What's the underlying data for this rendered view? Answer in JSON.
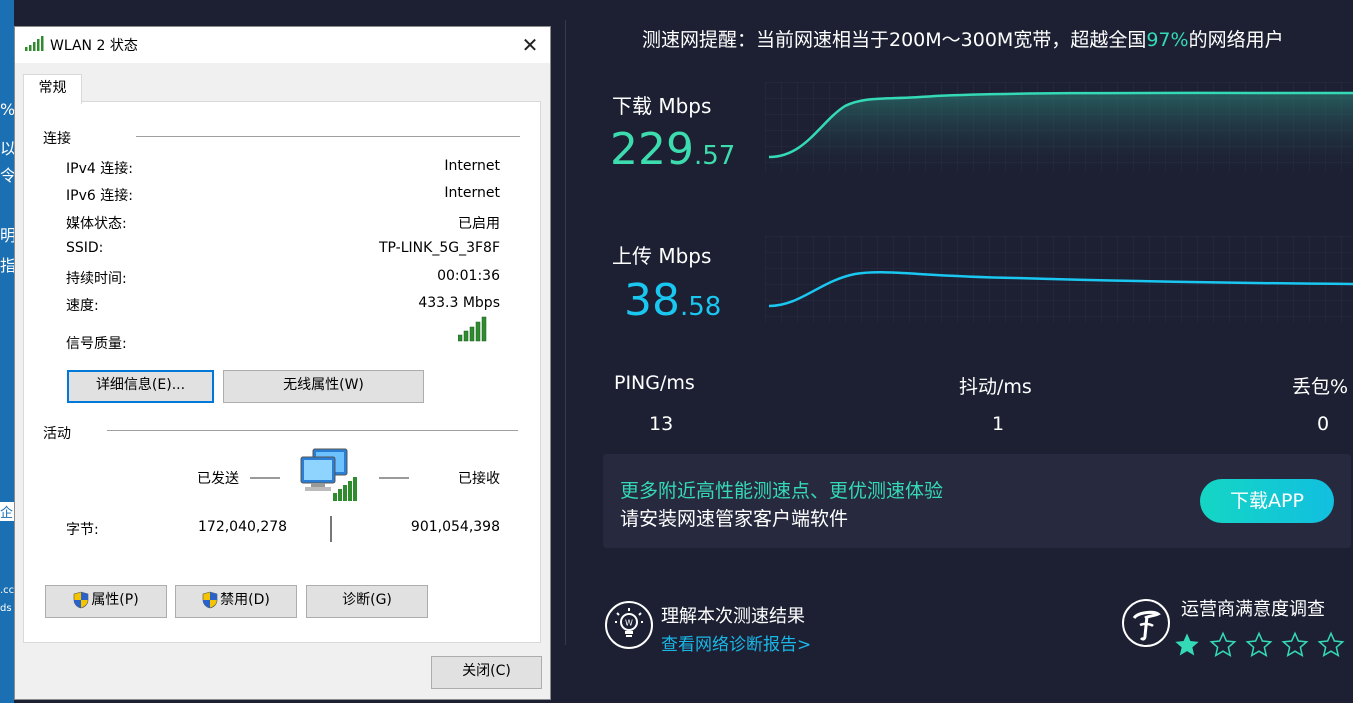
{
  "desktop": {
    "fragments": [
      "%",
      "以",
      "令",
      "明",
      "指",
      "企",
      ".cc",
      "ds"
    ]
  },
  "dialog": {
    "title": "WLAN 2 状态",
    "tab": "常规",
    "connection": {
      "header": "连接",
      "rows": [
        {
          "label": "IPv4 连接:",
          "value": "Internet"
        },
        {
          "label": "IPv6 连接:",
          "value": "Internet"
        },
        {
          "label": "媒体状态:",
          "value": "已启用"
        },
        {
          "label": "SSID:",
          "value": "TP-LINK_5G_3F8F"
        },
        {
          "label": "持续时间:",
          "value": "00:01:36"
        },
        {
          "label": "速度:",
          "value": "433.3 Mbps"
        }
      ],
      "signal_label": "信号质量:",
      "signal_level": 5,
      "details_button": "详细信息(E)...",
      "wireless_button": "无线属性(W)"
    },
    "activity": {
      "header": "活动",
      "sent_label": "已发送",
      "received_label": "已接收",
      "bytes_label": "字节:",
      "sent_bytes": "172,040,278",
      "received_bytes": "901,054,398"
    },
    "buttons": {
      "properties": "属性(P)",
      "disable": "禁用(D)",
      "diagnose": "诊断(G)",
      "close": "关闭(C)"
    }
  },
  "speedtest": {
    "notice_prefix": "测速网提醒：当前网速相当于200M～300M宽带，超越全国",
    "notice_percent": "97%",
    "notice_suffix": "的网络用户",
    "download": {
      "label": "下载 Mbps",
      "int": "229",
      "dec": ".57"
    },
    "upload": {
      "label": "上传 Mbps",
      "int": "38",
      "dec": ".58"
    },
    "stats": [
      {
        "label": "PING/ms",
        "value": "13"
      },
      {
        "label": "抖动/ms",
        "value": "1"
      },
      {
        "label": "丢包%",
        "value": "0"
      }
    ],
    "promo": {
      "line1": "更多附近高性能测速点、更优测速体验",
      "line2": "请安装网速管家客户端软件",
      "button": "下载APP"
    },
    "report": {
      "title": "理解本次测速结果",
      "link": "查看网络诊断报告>"
    },
    "survey": {
      "title": "运营商满意度调查",
      "stars_filled": 1,
      "stars_total": 5
    },
    "colors": {
      "accent": "#34d9b6",
      "upload": "#19c7f0",
      "bg": "#1d2033"
    }
  }
}
